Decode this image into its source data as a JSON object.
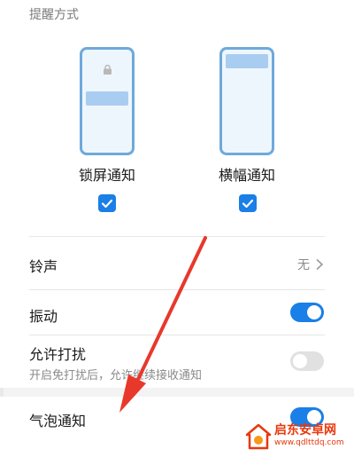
{
  "section": {
    "title": "提醒方式"
  },
  "styles": [
    {
      "label": "锁屏通知",
      "checked": true
    },
    {
      "label": "横幅通知",
      "checked": true
    }
  ],
  "rows": {
    "ringtone": {
      "label": "铃声",
      "value": "无"
    },
    "vibrate": {
      "label": "振动",
      "enabled": true
    },
    "dnd": {
      "label": "允许打扰",
      "subtitle": "开启免打扰后，允许继续接收通知",
      "enabled": false
    },
    "bubble": {
      "label": "气泡通知",
      "enabled": true
    }
  },
  "watermark": {
    "name": "启东安卓网",
    "url": "www.qdlttdq.com"
  },
  "colors": {
    "accent": "#1a7fe6",
    "annotation": "#e8382b"
  }
}
